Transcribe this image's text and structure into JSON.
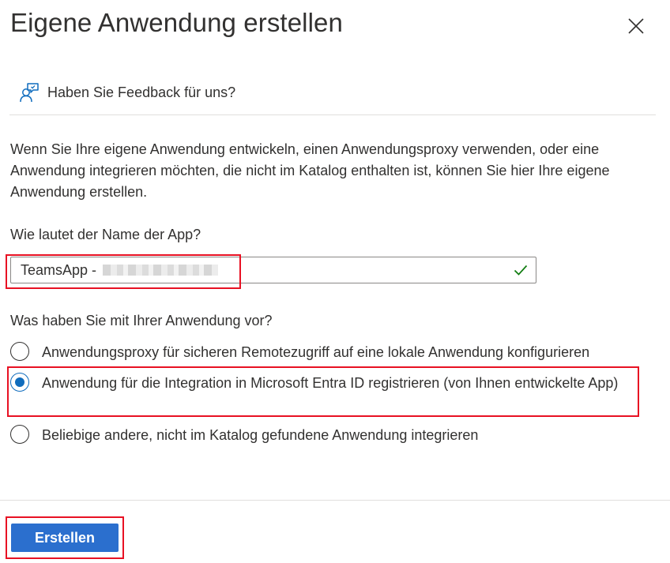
{
  "dialog": {
    "title": "Eigene Anwendung erstellen",
    "close_icon": "close-icon"
  },
  "feedback": {
    "icon": "feedback-person-icon",
    "label": "Haben Sie Feedback für uns?"
  },
  "description": "Wenn Sie Ihre eigene Anwendung entwickeln, einen Anwendungsproxy verwenden, oder eine Anwendung integrieren möchten, die nicht im Katalog enthalten ist, können Sie hier Ihre eigene Anwendung erstellen.",
  "name_field": {
    "label": "Wie lautet der Name der App?",
    "value": "TeamsApp -",
    "valid_icon": "checkmark-icon"
  },
  "intent": {
    "label": "Was haben Sie mit Ihrer Anwendung vor?",
    "selected_index": 1,
    "options": [
      {
        "label": "Anwendungsproxy für sicheren Remotezugriff auf eine lokale Anwendung konfigurieren",
        "checked": false
      },
      {
        "label": "Anwendung für die Integration in Microsoft Entra ID registrieren (von Ihnen entwickelte App)",
        "checked": true
      },
      {
        "label": "Beliebige andere, nicht im Katalog gefundene Anwendung integrieren",
        "checked": false
      }
    ]
  },
  "footer": {
    "create_label": "Erstellen"
  },
  "colors": {
    "accent": "#2b6fce",
    "radio_accent": "#0f6cbd",
    "highlight": "#e81123",
    "valid": "#107c10"
  }
}
